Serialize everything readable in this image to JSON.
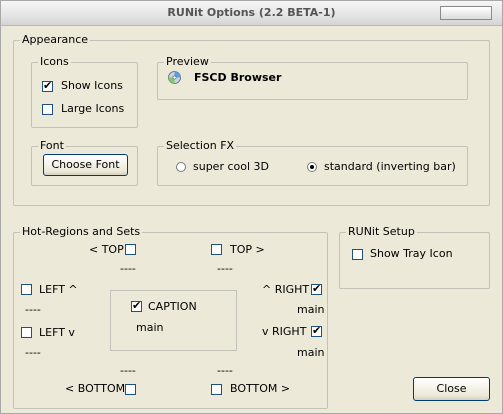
{
  "window": {
    "title": "RUNit Options (2.2 BETA-1)"
  },
  "appearance": {
    "label": "Appearance",
    "icons": {
      "label": "Icons",
      "show_icons": "Show Icons",
      "show_icons_checked": true,
      "large_icons": "Large Icons",
      "large_icons_checked": false
    },
    "preview": {
      "label": "Preview",
      "text": "FSCD Browser"
    },
    "font": {
      "label": "Font",
      "button": "Choose Font"
    },
    "selection_fx": {
      "label": "Selection FX",
      "option1": "super cool 3D",
      "option2": "standard (inverting bar)",
      "selected": "standard (inverting bar)"
    }
  },
  "hot_regions": {
    "label": "Hot-Regions and Sets",
    "top_left": {
      "label": "< TOP",
      "checked": false,
      "value": "----"
    },
    "top_right": {
      "label": "TOP >",
      "checked": false,
      "value": "----"
    },
    "left_up": {
      "label": "LEFT ^",
      "checked": false,
      "value": "----"
    },
    "left_down": {
      "label": "LEFT v",
      "checked": false,
      "value": "----"
    },
    "right_up": {
      "label": "^ RIGHT",
      "checked": true,
      "value": "main"
    },
    "right_down": {
      "label": "v RIGHT",
      "checked": true,
      "value": "main"
    },
    "caption": {
      "label": "CAPTION",
      "checked": true,
      "value": "main"
    },
    "bottom_left": {
      "label": "< BOTTOM",
      "checked": false,
      "value": "----"
    },
    "bottom_right": {
      "label": "BOTTOM >",
      "checked": false,
      "value": "----"
    }
  },
  "runit_setup": {
    "label": "RUNit Setup",
    "show_tray_icon": "Show Tray Icon",
    "show_tray_icon_checked": false
  },
  "close_button": "Close"
}
